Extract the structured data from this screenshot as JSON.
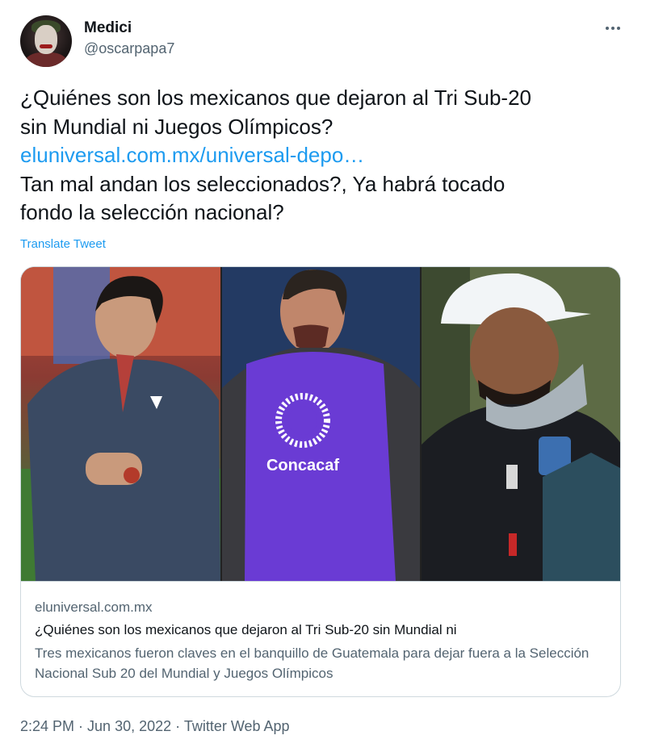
{
  "author": {
    "display_name": "Medici",
    "handle": "@oscarpapa7"
  },
  "tweet": {
    "line1": "¿Quiénes son los mexicanos que dejaron al Tri Sub-20",
    "line2": "sin Mundial ni Juegos Olímpicos?",
    "link": "eluniversal.com.mx/universal-depo…",
    "line3": "Tan mal andan los seleccionados?, Ya habrá tocado",
    "line4": "fondo la selección nacional?",
    "translate_label": "Translate Tweet"
  },
  "card": {
    "image_text": "Concacaf",
    "domain": "eluniversal.com.mx",
    "title": "¿Quiénes son los mexicanos que dejaron al Tri Sub-20 sin Mundial ni",
    "description": "Tres mexicanos fueron claves en el banquillo de Guatemala para dejar fuera a la Selección Nacional Sub 20 del Mundial y Juegos Olímpicos"
  },
  "meta": {
    "time": "2:24 PM",
    "separator": " · ",
    "date": "Jun 30, 2022",
    "source": "Twitter Web App"
  },
  "colors": {
    "link": "#1d9bf0",
    "text": "#0f1419",
    "secondary": "#536471",
    "border": "#cfd9de"
  },
  "icons": {
    "more": "more-horizontal-icon"
  }
}
